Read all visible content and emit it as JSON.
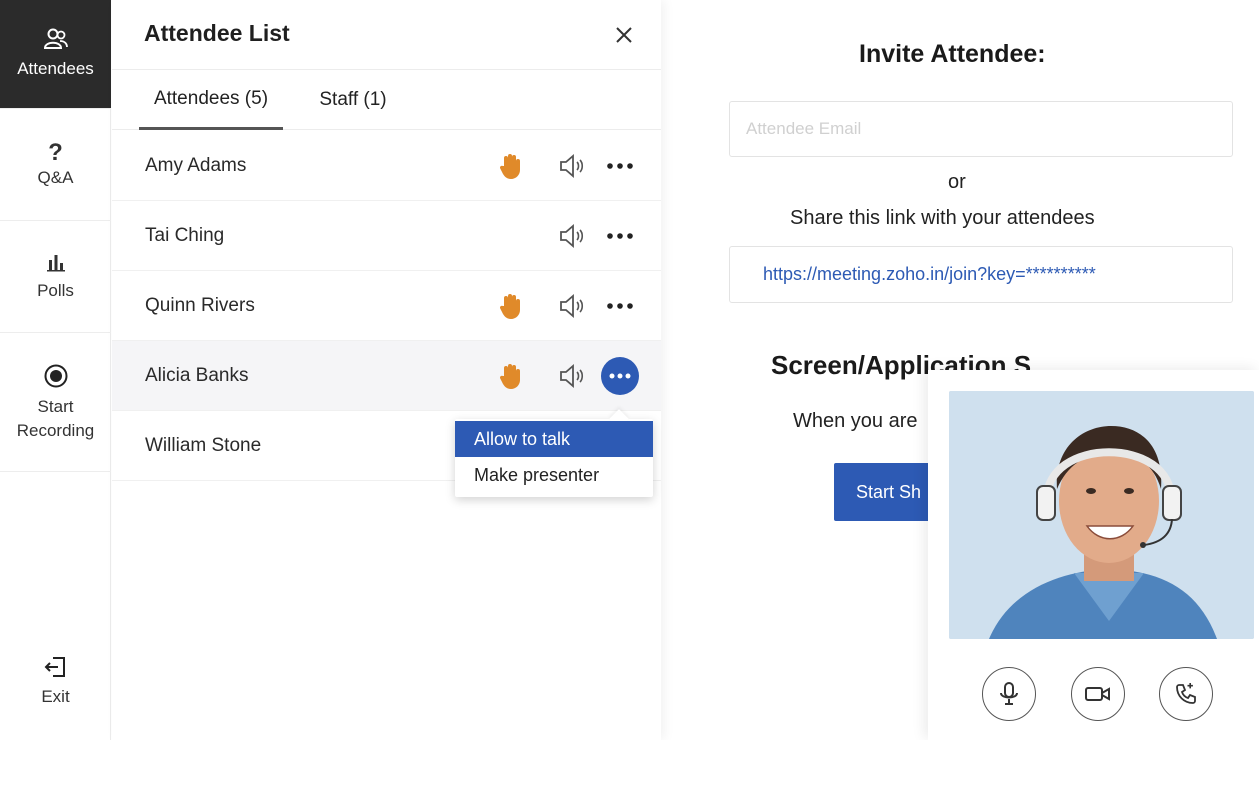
{
  "nav": {
    "items": [
      {
        "label": "Attendees",
        "icon": "users-icon"
      },
      {
        "label": "?",
        "sub": "Q&A",
        "icon": "question-icon"
      },
      {
        "label": "Polls",
        "icon": "bar-chart-icon"
      },
      {
        "label": "Start",
        "label2": "Recording",
        "icon": "record-icon"
      },
      {
        "label": "Exit",
        "icon": "exit-icon"
      }
    ]
  },
  "panel": {
    "title": "Attendee List",
    "tabs": [
      {
        "label": "Attendees (5)",
        "active": true
      },
      {
        "label": "Staff (1)",
        "active": false
      }
    ],
    "attendees": [
      {
        "name": "Amy Adams",
        "hand_raised": true
      },
      {
        "name": "Tai Ching",
        "hand_raised": false
      },
      {
        "name": "Quinn Rivers",
        "hand_raised": true
      },
      {
        "name": "Alicia Banks",
        "hand_raised": true,
        "menu_open": true
      },
      {
        "name": "William Stone",
        "hand_raised": false
      }
    ],
    "menu": {
      "items": [
        "Allow to talk",
        "Make presenter"
      ],
      "selected": "Allow to talk"
    }
  },
  "invite": {
    "title": "Invite Attendee:",
    "email_placeholder": "Attendee Email",
    "or": "or",
    "share_text": "Share this link with your attendees",
    "link": "https://meeting.zoho.in/join?key=**********",
    "sharing_title": "Screen/Application Sharing:",
    "sharing_desc": "When you are",
    "share_button": "Start Sh"
  },
  "colors": {
    "accent": "#2d5ab4",
    "hand": "#e08a2a",
    "nav_active": "#2b2b2b"
  }
}
